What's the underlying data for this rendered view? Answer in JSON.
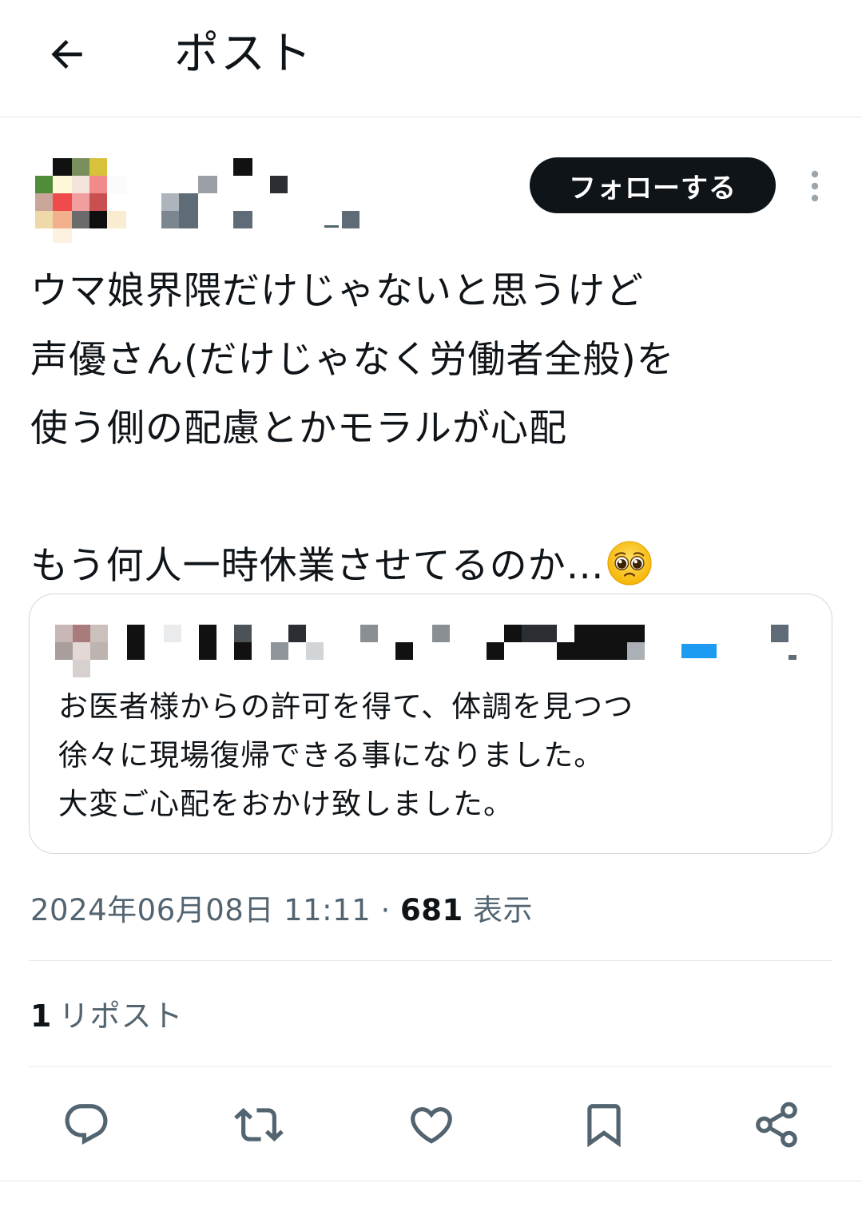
{
  "header": {
    "title": "ポスト",
    "back_icon": "arrow-left-icon"
  },
  "author": {
    "follow_label": "フォローする",
    "more_icon": "more-vertical-icon",
    "avatar_note": "pixelated",
    "name_note": "pixelated"
  },
  "post": {
    "text": "ウマ娘界隈だけじゃないと思うけど\n声優さん(だけじゃなく労働者全般)を\n使う側の配慮とかモラルが心配\n\nもう何人一時休業させてるのか…",
    "emoji": "pleading-face-emoji"
  },
  "quote": {
    "text": "お医者様からの許可を得て、体調を見つつ\n徐々に現場復帰できる事になりました。\n大変ご心配をおかけ致しました。",
    "verified_badge_color": "#1d9bf0"
  },
  "meta": {
    "datetime": "2024年06月08日 11:11",
    "separator": "·",
    "views_count": "681",
    "views_label": "表示"
  },
  "stats": {
    "repost_count": "1",
    "repost_label": "リポスト"
  },
  "actions": [
    {
      "name": "reply",
      "icon": "reply-icon"
    },
    {
      "name": "repost",
      "icon": "repost-icon"
    },
    {
      "name": "like",
      "icon": "heart-icon"
    },
    {
      "name": "bookmark",
      "icon": "bookmark-icon"
    },
    {
      "name": "share",
      "icon": "share-icon"
    }
  ],
  "colors": {
    "text_primary": "#0f1419",
    "text_secondary": "#536471",
    "border": "#cfd9de",
    "follow_button_bg": "#0f1419",
    "accent_blue": "#1d9bf0"
  }
}
